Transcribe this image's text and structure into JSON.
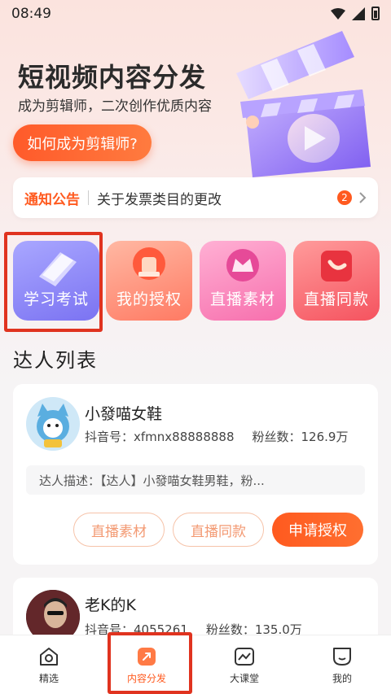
{
  "status_bar": {
    "time": "08:49"
  },
  "banner": {
    "title": "短视频内容分发",
    "subtitle": "成为剪辑师，二次创作优质内容",
    "button_label": "如何成为剪辑师?"
  },
  "notice": {
    "label": "通知公告",
    "text": "关于发票类目的更改",
    "badge_count": "2"
  },
  "tiles": [
    {
      "label": "学习考试"
    },
    {
      "label": "我的授权"
    },
    {
      "label": "直播素材"
    },
    {
      "label": "直播同款"
    }
  ],
  "section_title": "达人列表",
  "influencers": [
    {
      "name": "小發喵女鞋",
      "douyin_id": "抖音号：xfmnx88888888",
      "fans": "粉丝数：126.9万",
      "description": "达人描述：【达人】小發喵女鞋男鞋，粉..."
    },
    {
      "name": "老K的K",
      "douyin_id": "抖音号：4055261",
      "fans": "粉丝数：135.0万"
    }
  ],
  "card_actions": {
    "material": "直播素材",
    "same": "直播同款",
    "apply": "申请授权"
  },
  "bottom_nav": [
    {
      "label": "精选",
      "icon": "home-icon"
    },
    {
      "label": "内容分发",
      "icon": "share-icon"
    },
    {
      "label": "大课堂",
      "icon": "classroom-icon"
    },
    {
      "label": "我的",
      "icon": "profile-icon"
    }
  ],
  "colors": {
    "accent": "#ff5a1f",
    "highlight": "#e0331f"
  }
}
